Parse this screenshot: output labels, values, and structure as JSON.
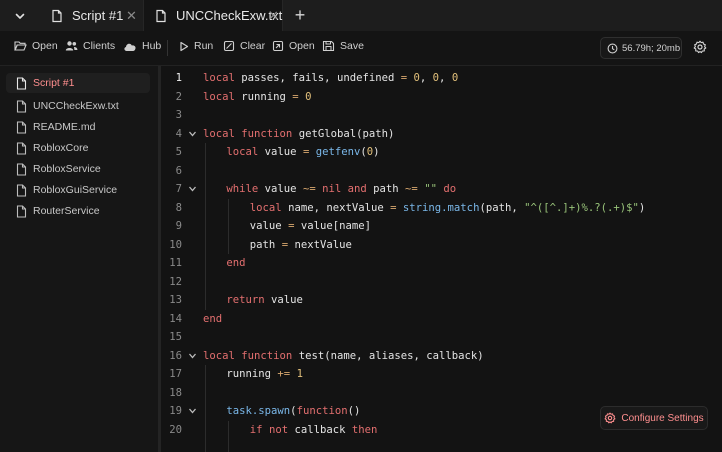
{
  "tabs": [
    {
      "label": "Script #1",
      "close": "✕"
    },
    {
      "label": "UNCCheckExw.txt",
      "close": "✕"
    }
  ],
  "add_tab_label": "+",
  "toolbar": {
    "open_label": "Open",
    "clients_label": "Clients",
    "hub_label": "Hub",
    "run_label": "Run",
    "clear_label": "Clear",
    "open2_label": "Open",
    "save_label": "Save",
    "status": "56.79h; 20mb"
  },
  "sidebar": {
    "files": [
      {
        "label": "Script #1",
        "active": true
      },
      {
        "label": "UNCCheckExw.txt"
      },
      {
        "label": "README.md"
      },
      {
        "label": "RobloxCore"
      },
      {
        "label": "RobloxService"
      },
      {
        "label": "RobloxGuiService"
      },
      {
        "label": "RouterService"
      }
    ]
  },
  "editor": {
    "current_line": 1,
    "lines": [
      {
        "n": "1",
        "fold": false,
        "indent": 0,
        "tokens": [
          [
            "kw",
            "local"
          ],
          [
            "id",
            " passes, fails, undefined "
          ],
          [
            "op",
            "="
          ],
          [
            "id",
            " "
          ],
          [
            "num",
            "0"
          ],
          [
            "id",
            ", "
          ],
          [
            "num",
            "0"
          ],
          [
            "id",
            ", "
          ],
          [
            "num",
            "0"
          ]
        ]
      },
      {
        "n": "2",
        "fold": false,
        "indent": 0,
        "tokens": [
          [
            "kw",
            "local"
          ],
          [
            "id",
            " running "
          ],
          [
            "op",
            "="
          ],
          [
            "id",
            " "
          ],
          [
            "num",
            "0"
          ]
        ]
      },
      {
        "n": "3",
        "fold": false,
        "indent": 0,
        "tokens": []
      },
      {
        "n": "4",
        "fold": true,
        "indent": 0,
        "tokens": [
          [
            "kw",
            "local"
          ],
          [
            "id",
            " "
          ],
          [
            "kw",
            "function"
          ],
          [
            "id",
            " getGlobal(path)"
          ]
        ]
      },
      {
        "n": "5",
        "fold": false,
        "indent": 1,
        "tokens": [
          [
            "kw",
            "local"
          ],
          [
            "id",
            " value "
          ],
          [
            "op",
            "="
          ],
          [
            "id",
            " "
          ],
          [
            "bi",
            "getfenv"
          ],
          [
            "id",
            "("
          ],
          [
            "num",
            "0"
          ],
          [
            "id",
            ")"
          ]
        ]
      },
      {
        "n": "6",
        "fold": false,
        "indent": 1,
        "tokens": []
      },
      {
        "n": "7",
        "fold": true,
        "indent": 1,
        "tokens": [
          [
            "kw",
            "while"
          ],
          [
            "id",
            " value "
          ],
          [
            "op",
            "~="
          ],
          [
            "id",
            " "
          ],
          [
            "kw",
            "nil"
          ],
          [
            "id",
            " "
          ],
          [
            "kw",
            "and"
          ],
          [
            "id",
            " path "
          ],
          [
            "op",
            "~="
          ],
          [
            "id",
            " "
          ],
          [
            "str",
            "\"\""
          ],
          [
            "id",
            " "
          ],
          [
            "kw",
            "do"
          ]
        ]
      },
      {
        "n": "8",
        "fold": false,
        "indent": 2,
        "tokens": [
          [
            "kw",
            "local"
          ],
          [
            "id",
            " name, nextValue "
          ],
          [
            "op",
            "="
          ],
          [
            "id",
            " "
          ],
          [
            "bi",
            "string.match"
          ],
          [
            "id",
            "(path, "
          ],
          [
            "str",
            "\"^([^.]+)%.?(.+)$\""
          ],
          [
            "id",
            ")"
          ]
        ]
      },
      {
        "n": "9",
        "fold": false,
        "indent": 2,
        "tokens": [
          [
            "id",
            "value "
          ],
          [
            "op",
            "="
          ],
          [
            "id",
            " value[name]"
          ]
        ]
      },
      {
        "n": "10",
        "fold": false,
        "indent": 2,
        "tokens": [
          [
            "id",
            "path "
          ],
          [
            "op",
            "="
          ],
          [
            "id",
            " nextValue"
          ]
        ]
      },
      {
        "n": "11",
        "fold": false,
        "indent": 1,
        "tokens": [
          [
            "kw",
            "end"
          ]
        ]
      },
      {
        "n": "12",
        "fold": false,
        "indent": 1,
        "tokens": []
      },
      {
        "n": "13",
        "fold": false,
        "indent": 1,
        "tokens": [
          [
            "kw",
            "return"
          ],
          [
            "id",
            " value"
          ]
        ]
      },
      {
        "n": "14",
        "fold": false,
        "indent": 0,
        "tokens": [
          [
            "kw",
            "end"
          ]
        ]
      },
      {
        "n": "15",
        "fold": false,
        "indent": 0,
        "tokens": []
      },
      {
        "n": "16",
        "fold": true,
        "indent": 0,
        "tokens": [
          [
            "kw",
            "local"
          ],
          [
            "id",
            " "
          ],
          [
            "kw",
            "function"
          ],
          [
            "id",
            " "
          ],
          [
            "fn",
            "test"
          ],
          [
            "id",
            "(name, aliases, callback)"
          ]
        ]
      },
      {
        "n": "17",
        "fold": false,
        "indent": 1,
        "tokens": [
          [
            "id",
            "running "
          ],
          [
            "op",
            "+="
          ],
          [
            "id",
            " "
          ],
          [
            "num",
            "1"
          ]
        ]
      },
      {
        "n": "18",
        "fold": false,
        "indent": 1,
        "tokens": []
      },
      {
        "n": "19",
        "fold": true,
        "indent": 1,
        "tokens": [
          [
            "bi",
            "task.spawn"
          ],
          [
            "id",
            "("
          ],
          [
            "kw",
            "function"
          ],
          [
            "id",
            "()"
          ]
        ]
      },
      {
        "n": "20",
        "fold": false,
        "indent": 2,
        "tokens": [
          [
            "kw",
            "if"
          ],
          [
            "id",
            " "
          ],
          [
            "kw",
            "not"
          ],
          [
            "id",
            " callback "
          ],
          [
            "kw",
            "then"
          ]
        ]
      },
      {
        "n": "",
        "fold": false,
        "indent": 2,
        "tokens": []
      }
    ]
  },
  "configure_label": "Configure Settings",
  "colors": {
    "accent": "#ff8f8f",
    "keyword": "#e36f6f",
    "number": "#e2c07b",
    "string": "#98c379",
    "builtin": "#7ab7e8"
  }
}
